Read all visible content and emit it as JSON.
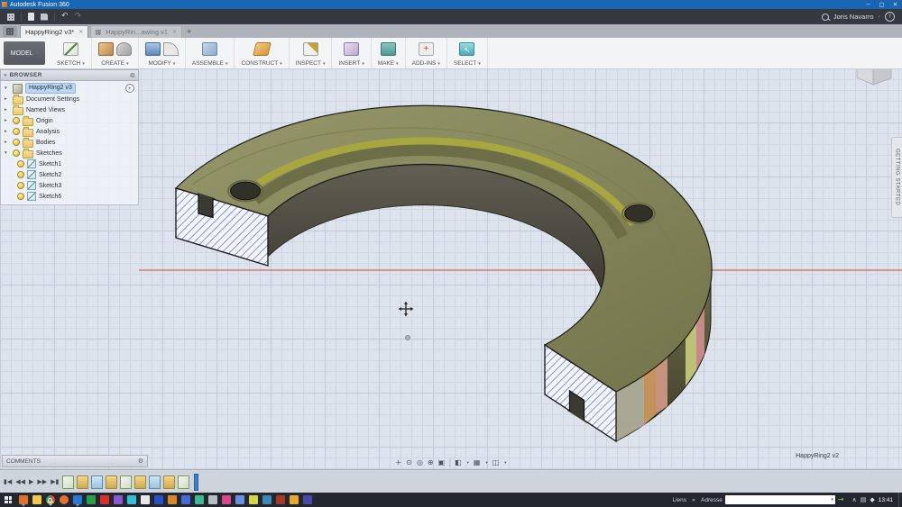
{
  "titlebar": {
    "title": "Autodesk Fusion 360"
  },
  "appbar": {
    "user": "Joris Navarro"
  },
  "tabs": {
    "active_label": "HappyRing2 v3*",
    "secondary_label": "HappyRin...awing v1",
    "new_tab": "+"
  },
  "ribbon": {
    "workspace_label": "MODEL",
    "groups": [
      {
        "label": "SKETCH"
      },
      {
        "label": "CREATE"
      },
      {
        "label": "MODIFY"
      },
      {
        "label": "ASSEMBLE"
      },
      {
        "label": "CONSTRUCT"
      },
      {
        "label": "INSPECT"
      },
      {
        "label": "INSERT"
      },
      {
        "label": "MAKE"
      },
      {
        "label": "ADD-INS"
      },
      {
        "label": "SELECT"
      }
    ]
  },
  "browser": {
    "header": "BROWSER",
    "root_label": "HappyRing2 v3",
    "items": [
      {
        "label": "Document Settings"
      },
      {
        "label": "Named Views"
      },
      {
        "label": "Origin"
      },
      {
        "label": "Analysis"
      },
      {
        "label": "Bodies"
      },
      {
        "label": "Sketches"
      }
    ],
    "sketches": [
      {
        "label": "Sketch1"
      },
      {
        "label": "Sketch2"
      },
      {
        "label": "Sketch3"
      },
      {
        "label": "Sketch6"
      }
    ]
  },
  "canvas": {
    "document_label": "HappyRing2 v2",
    "getting_started_label": "GETTING STARTED"
  },
  "comments": {
    "header": "COMMENTS"
  },
  "taskbar": {
    "links_label": "Liens",
    "links_chevron": "»",
    "address_label": "Adresse",
    "time": "13:41"
  },
  "glyphs": {
    "caret_down": "▾",
    "caret_right": "▸",
    "close": "✕",
    "plus": "+",
    "minimize": "─",
    "maximize": "▢",
    "undo": "↶",
    "redo": "↷",
    "help": "?",
    "chevrons_left": "«",
    "gear": "⚙",
    "skip_start": "▮◀",
    "step_back": "◀◀",
    "play": "▶",
    "step_fwd": "▶▶",
    "skip_end": "▶▮",
    "pan": "+",
    "orbit": "⊙",
    "look_at": "◎",
    "zoom": "⊕",
    "window_zoom": "▣",
    "display_settings": "◧",
    "grid_settings": "▦",
    "viewports": "◫",
    "tray_up": "∧",
    "tray_network": "▤",
    "tray_volume": "◆",
    "address_go": "→"
  },
  "colors": {
    "titlebar_blue": "#1a64b4",
    "appbar_dark": "#34383f",
    "model_top_olive": "#8b8b5c",
    "hatch_blue": "#5c6fc9",
    "axis_red": "#c84a3e",
    "selection_blue": "#bcd6f2",
    "groove_yellow": "#a9a93e",
    "taskbar_dark": "#23272f"
  },
  "icons": {
    "app_grid": "apps-grid",
    "taskbar_apps": [
      "fusion-360",
      "file-explorer",
      "chrome",
      "firefox",
      "app",
      "excel",
      "pdf",
      "app",
      "app",
      "app",
      "word",
      "app",
      "app",
      "app",
      "app",
      "app",
      "app",
      "app",
      "app",
      "app",
      "app",
      "app"
    ]
  }
}
